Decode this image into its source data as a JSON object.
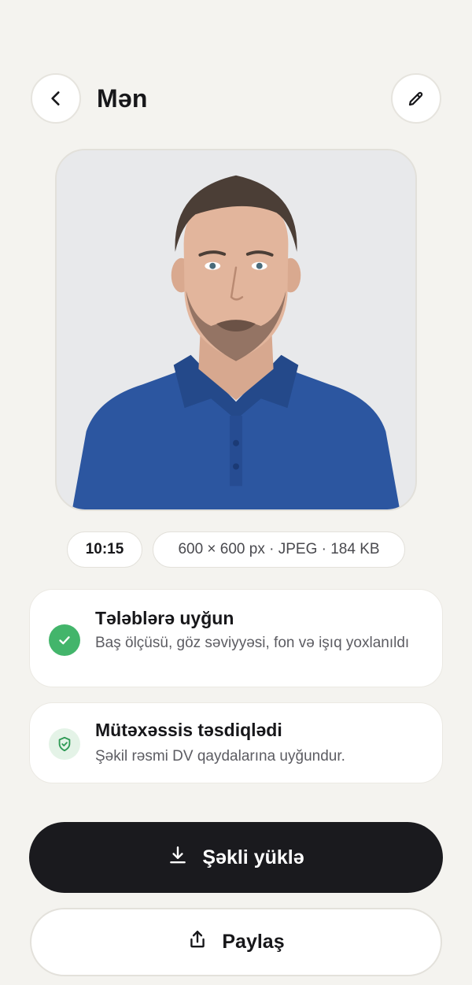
{
  "header": {
    "title": "Mən",
    "back_icon": "chevron-left-icon",
    "edit_icon": "pencil-icon"
  },
  "photo": {
    "description_icon": "portrait-photo"
  },
  "meta": {
    "time": "10:15",
    "info": "600 × 600 px · JPEG · 184 KB"
  },
  "checks": {
    "requirements": {
      "title": "Tələblərə uyğun",
      "description": "Baş ölçüsü, göz səviyyəsi, fon və işıq yoxlanıldı",
      "icon": "check-circle-icon",
      "color": "#43b56b"
    },
    "expert": {
      "title": "Mütəxəssis təsdiqlədi",
      "description": "Şəkil rəsmi DV qaydalarına uyğundur.",
      "icon": "shield-check-icon",
      "color": "#e4f3e7"
    }
  },
  "actions": {
    "download_label": "Şəkli yüklə",
    "download_icon": "download-icon",
    "share_label": "Paylaş",
    "share_icon": "share-icon"
  },
  "colors": {
    "background": "#f4f3ef",
    "primary": "#1a1a1e",
    "success": "#43b56b"
  }
}
